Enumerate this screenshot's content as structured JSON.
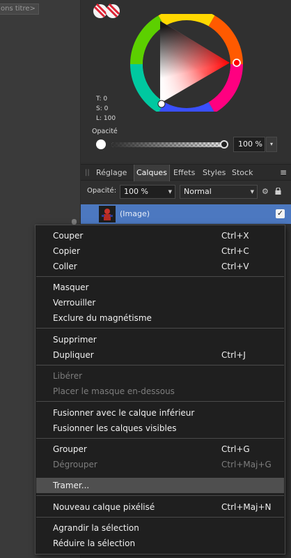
{
  "document": {
    "tab_title": "ons titre>"
  },
  "color_panel": {
    "hsl": {
      "t": "T: 0",
      "s": "S: 0",
      "l": "L: 100"
    },
    "opacity_label": "Opacité",
    "opacity_value": "100 %",
    "opacity_level": 1.0,
    "hue_handle_color": "#ff0000"
  },
  "tabs": {
    "items": [
      {
        "label": "Réglage"
      },
      {
        "label": "Calques"
      },
      {
        "label": "Effets"
      },
      {
        "label": "Styles"
      },
      {
        "label": "Stock"
      }
    ],
    "active": "Calques"
  },
  "layer_options": {
    "opacity_label": "Opacité:",
    "opacity_value": "100 %",
    "blend_mode": "Normal"
  },
  "layer": {
    "name": "(Image)",
    "selected_color": "#4c78c0"
  },
  "context_menu": {
    "items": [
      {
        "label": "Couper",
        "shortcut": "Ctrl+X"
      },
      {
        "label": "Copier",
        "shortcut": "Ctrl+C"
      },
      {
        "label": "Coller",
        "shortcut": "Ctrl+V"
      },
      {
        "label": "Masquer"
      },
      {
        "label": "Verrouiller"
      },
      {
        "label": "Exclure du magnétisme"
      },
      {
        "label": "Supprimer"
      },
      {
        "label": "Dupliquer",
        "shortcut": "Ctrl+J"
      },
      {
        "label": "Libérer"
      },
      {
        "label": "Placer le masque en-dessous"
      },
      {
        "label": "Fusionner avec le calque inférieur"
      },
      {
        "label": "Fusionner les calques visibles"
      },
      {
        "label": "Grouper",
        "shortcut": "Ctrl+G"
      },
      {
        "label": "Dégrouper",
        "shortcut": "Ctrl+Maj+G"
      },
      {
        "label": "Tramer..."
      },
      {
        "label": "Nouveau calque pixélisé",
        "shortcut": "Ctrl+Maj+N"
      },
      {
        "label": "Agrandir la sélection"
      },
      {
        "label": "Réduire la sélection"
      }
    ]
  }
}
